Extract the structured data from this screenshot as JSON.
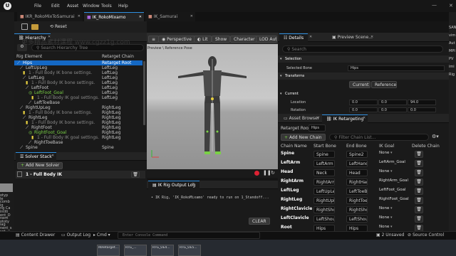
{
  "menu": {
    "logo": "U",
    "items": [
      "File",
      "Edit",
      "Asset",
      "Window",
      "Tools",
      "Help"
    ]
  },
  "doc_tabs": [
    {
      "label": "IKR_RokoMixToSamurai",
      "active": false
    },
    {
      "label": "IK_RokoMixamo",
      "active": true
    },
    {
      "label": "IK_Samurai",
      "active": false
    }
  ],
  "toolbar": {
    "reset_label": "Reset"
  },
  "hierarchy": {
    "tab_label": "Hierarchy",
    "search_placeholder": "Search Hierarchy Tree",
    "col_element": "Rig Element",
    "col_chain": "Retarget Chain",
    "rows": [
      {
        "label": "Hips",
        "chain": "Retarget Root",
        "kind": "bone",
        "indent": 0,
        "selected": true
      },
      {
        "label": "LeftUpLeg",
        "chain": "LeftLeg",
        "kind": "bone",
        "indent": 1,
        "selected": false
      },
      {
        "label": "1 - Full Body IK bone settings.",
        "chain": "LeftLeg",
        "kind": "setting",
        "indent": 2,
        "selected": false
      },
      {
        "label": "LeftLeg",
        "chain": "LeftLeg",
        "kind": "bone",
        "indent": 2,
        "selected": false
      },
      {
        "label": "1 - Full Body IK bone settings.",
        "chain": "LeftLeg",
        "kind": "setting",
        "indent": 3,
        "selected": false
      },
      {
        "label": "LeftFoot",
        "chain": "LeftLeg",
        "kind": "bone",
        "indent": 3,
        "selected": false
      },
      {
        "label": "LeftFoot_Goal",
        "chain": "LeftLeg",
        "kind": "goal",
        "indent": 4,
        "selected": false
      },
      {
        "label": "1 - Full Body IK goal settings.",
        "chain": "LeftLeg",
        "kind": "setting",
        "indent": 5,
        "selected": false
      },
      {
        "label": "LeftToeBase",
        "chain": "",
        "kind": "bone",
        "indent": 4,
        "selected": false
      },
      {
        "label": "RightUpLeg",
        "chain": "RightLeg",
        "kind": "bone",
        "indent": 1,
        "selected": false
      },
      {
        "label": "1 - Full Body IK bone settings.",
        "chain": "RightLeg",
        "kind": "setting",
        "indent": 2,
        "selected": false
      },
      {
        "label": "RightLeg",
        "chain": "RightLeg",
        "kind": "bone",
        "indent": 2,
        "selected": false
      },
      {
        "label": "1 - Full Body IK bone settings.",
        "chain": "RightLeg",
        "kind": "setting",
        "indent": 3,
        "selected": false
      },
      {
        "label": "RightFoot",
        "chain": "RightLeg",
        "kind": "bone",
        "indent": 3,
        "selected": false
      },
      {
        "label": "RightFoot_Goal",
        "chain": "RightLeg",
        "kind": "goal",
        "indent": 4,
        "selected": false
      },
      {
        "label": "1 - Full Body IK goal settings.",
        "chain": "RightLeg",
        "kind": "setting",
        "indent": 5,
        "selected": false
      },
      {
        "label": "RightToeBase",
        "chain": "",
        "kind": "bone",
        "indent": 4,
        "selected": false
      },
      {
        "label": "Spine",
        "chain": "Spine",
        "kind": "bone",
        "indent": 1,
        "selected": false
      }
    ]
  },
  "solver_stack": {
    "tab_label": "Solver Stack",
    "add_label": "Add New Solver",
    "solver_label": "1 - Full Body IK"
  },
  "viewport": {
    "perspective": "Perspective",
    "lit": "Lit",
    "show": "Show",
    "character": "Character",
    "lod": "LOD Auto",
    "preview_label": "Preview",
    "preview_suffix": "\\ Reference Pose"
  },
  "output_log": {
    "tab_label": "IK Rig Output Log",
    "message": "IK Rig, 'IK_RokoMixamo' ready to run on 1_Standoff...",
    "clear_label": "CLEAR"
  },
  "details": {
    "tab_label": "Details",
    "preview_tab": "Preview Scene...",
    "search_placeholder": "Search",
    "section_selection": "Selection",
    "selected_bone_label": "Selected Bone",
    "selected_bone_value": "Hips",
    "section_transforms": "Transforms",
    "btn_current": "Current",
    "btn_reference": "Reference",
    "section_current": "Current",
    "location_label": "Location",
    "location_values": [
      "0.0",
      "0.0",
      "94.0"
    ],
    "rotation_label": "Rotation",
    "rotation_values": [
      "0.0",
      "0.0",
      "0.0"
    ]
  },
  "retargeting": {
    "tab_asset": "Asset Browser",
    "tab_ik": "IK Retargeting",
    "root_label": "Retarget Root:",
    "root_value": "Hips",
    "add_chain_label": "Add New Chain",
    "filter_placeholder": "Filter Chain List...",
    "col_chain_name": "Chain Name",
    "col_start": "Start Bone",
    "col_end": "End Bone",
    "col_goal": "IK Goal",
    "col_delete": "Delete Chain",
    "chains": [
      {
        "name": "Spine",
        "start": "Spine",
        "end": "Spine2",
        "goal": "None"
      },
      {
        "name": "LeftArm",
        "start": "LeftArm",
        "end": "LeftHand",
        "goal": "LeftArm_Goal"
      },
      {
        "name": "Head",
        "start": "Neck",
        "end": "Head",
        "goal": "None"
      },
      {
        "name": "RightArm",
        "start": "RightArm",
        "end": "RightHand",
        "goal": "RightArm_Goal"
      },
      {
        "name": "LeftLeg",
        "start": "LeftUpLeg",
        "end": "LeftToeBase",
        "goal": "LeftFoot_Goal"
      },
      {
        "name": "RightLeg",
        "start": "RightUpLeg",
        "end": "RightToeBase",
        "goal": "RightFoot_Goal"
      },
      {
        "name": "RightClavicle",
        "start": "RightShoulder",
        "end": "RightShoulder",
        "goal": "None"
      },
      {
        "name": "LeftClavicle",
        "start": "LeftShoulder",
        "end": "LeftShoulder",
        "goal": "None"
      },
      {
        "name": "Root",
        "start": "Hips",
        "end": "Hips",
        "goal": "None"
      }
    ]
  },
  "statusbar": {
    "content_drawer": "Content Drawer",
    "output_log": "Output Log",
    "cmd": "Cmd",
    "console_placeholder": "Enter Console Command",
    "unsaved": "2 Unsaved",
    "source_control": "Source Control"
  },
  "taskbar_thumbs": [
    "IKRetarget...",
    "RTG_...",
    "RTG_UE4...",
    "RTG_UE5..."
  ],
  "right_edge_texts": [
    "SAN",
    "vim",
    "Aut",
    "MPI",
    "PV",
    "imi",
    "Rig"
  ],
  "left_edge_texts": [
    "otyp",
    "le",
    "comb",
    "ig",
    "ng Ca",
    "intiti",
    "ent_D",
    "nent",
    "ototy",
    "iag",
    "nent_s",
    "set"
  ],
  "watermark": "更多精品素材课程 www.cgzz1g.com",
  "colors": {
    "accent": "#1468c4",
    "goal": "#7ad146",
    "panel": "#1a1a1a",
    "header": "#242424"
  }
}
